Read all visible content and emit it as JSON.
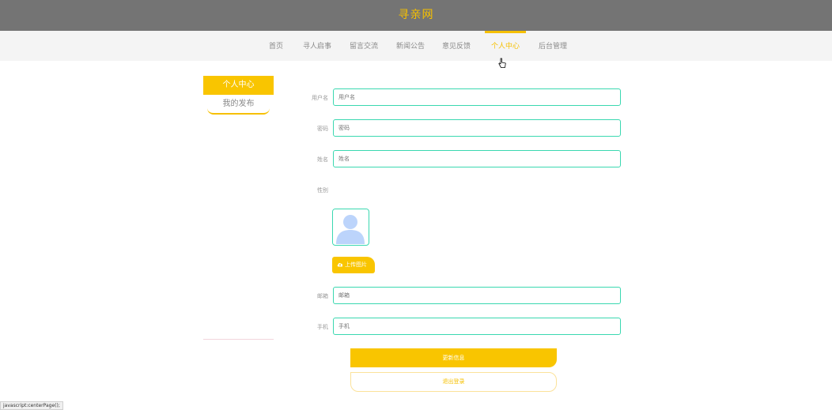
{
  "header": {
    "site_title": "寻亲网"
  },
  "nav": {
    "items": [
      {
        "label": "首页"
      },
      {
        "label": "寻人启事"
      },
      {
        "label": "留言交流"
      },
      {
        "label": "新闻公告"
      },
      {
        "label": "意见反馈"
      },
      {
        "label": "个人中心"
      },
      {
        "label": "后台管理"
      }
    ],
    "active": "个人中心"
  },
  "sidebar": {
    "title": "个人中心",
    "link": "我的发布"
  },
  "form": {
    "username": {
      "label": "用户名",
      "placeholder": "用户名"
    },
    "password": {
      "label": "密码",
      "placeholder": "密码"
    },
    "name": {
      "label": "姓名",
      "placeholder": "姓名"
    },
    "gender": {
      "label": "性别"
    },
    "upload_label": "上传图片",
    "email": {
      "label": "邮箱",
      "placeholder": "邮箱"
    },
    "phone": {
      "label": "手机",
      "placeholder": "手机"
    }
  },
  "actions": {
    "update": "更新信息",
    "logout": "退出登录"
  },
  "statusbar": {
    "text": "javascript:centerPage();"
  },
  "colors": {
    "accent": "#f9c500",
    "topbar": "#747474",
    "field_border": "#3ad8b0",
    "avatar": "#bcd4fb"
  }
}
